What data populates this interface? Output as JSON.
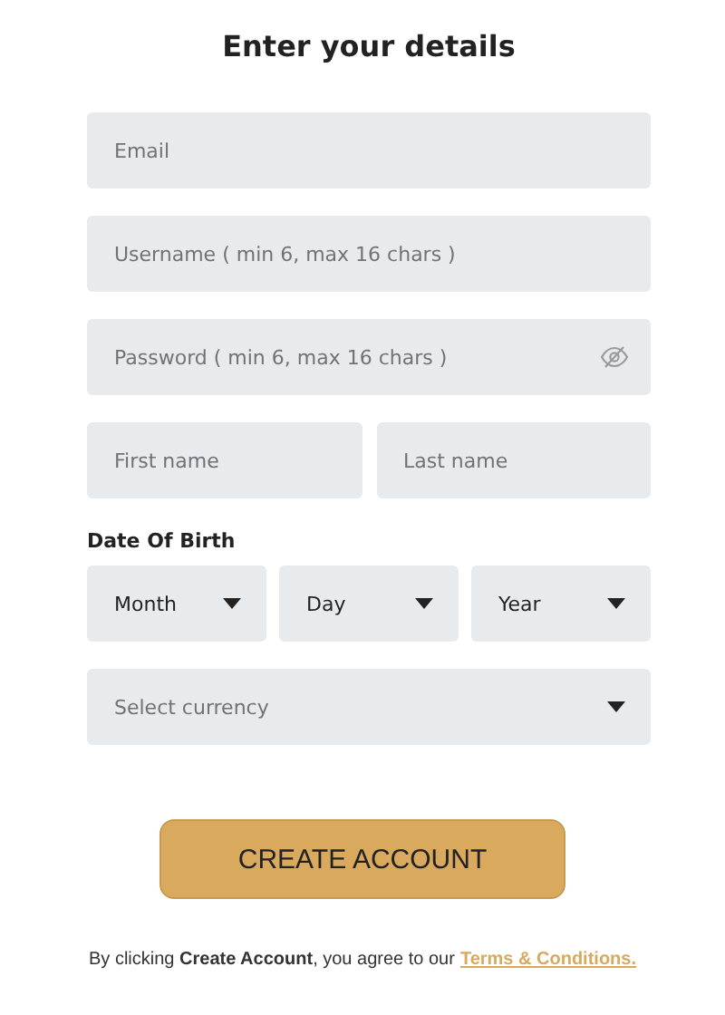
{
  "title": "Enter your details",
  "fields": [
    {
      "placeholder": "Email",
      "kind": "text"
    },
    {
      "placeholder": "Username ( min 6, max 16 chars )",
      "kind": "text"
    },
    {
      "placeholder": "Password ( min 6, max 16 chars )",
      "kind": "password"
    }
  ],
  "name_fields": [
    {
      "placeholder": "First name"
    },
    {
      "placeholder": "Last name"
    }
  ],
  "dob": {
    "label": "Date Of Birth",
    "selects": [
      {
        "value": "Month"
      },
      {
        "value": "Day"
      },
      {
        "value": "Year"
      }
    ]
  },
  "currency": {
    "placeholder": "Select currency"
  },
  "button": "CREATE ACCOUNT",
  "footer": {
    "text": "By clicking **Create Account**, you agree to our",
    "link": "Terms & Conditions."
  }
}
